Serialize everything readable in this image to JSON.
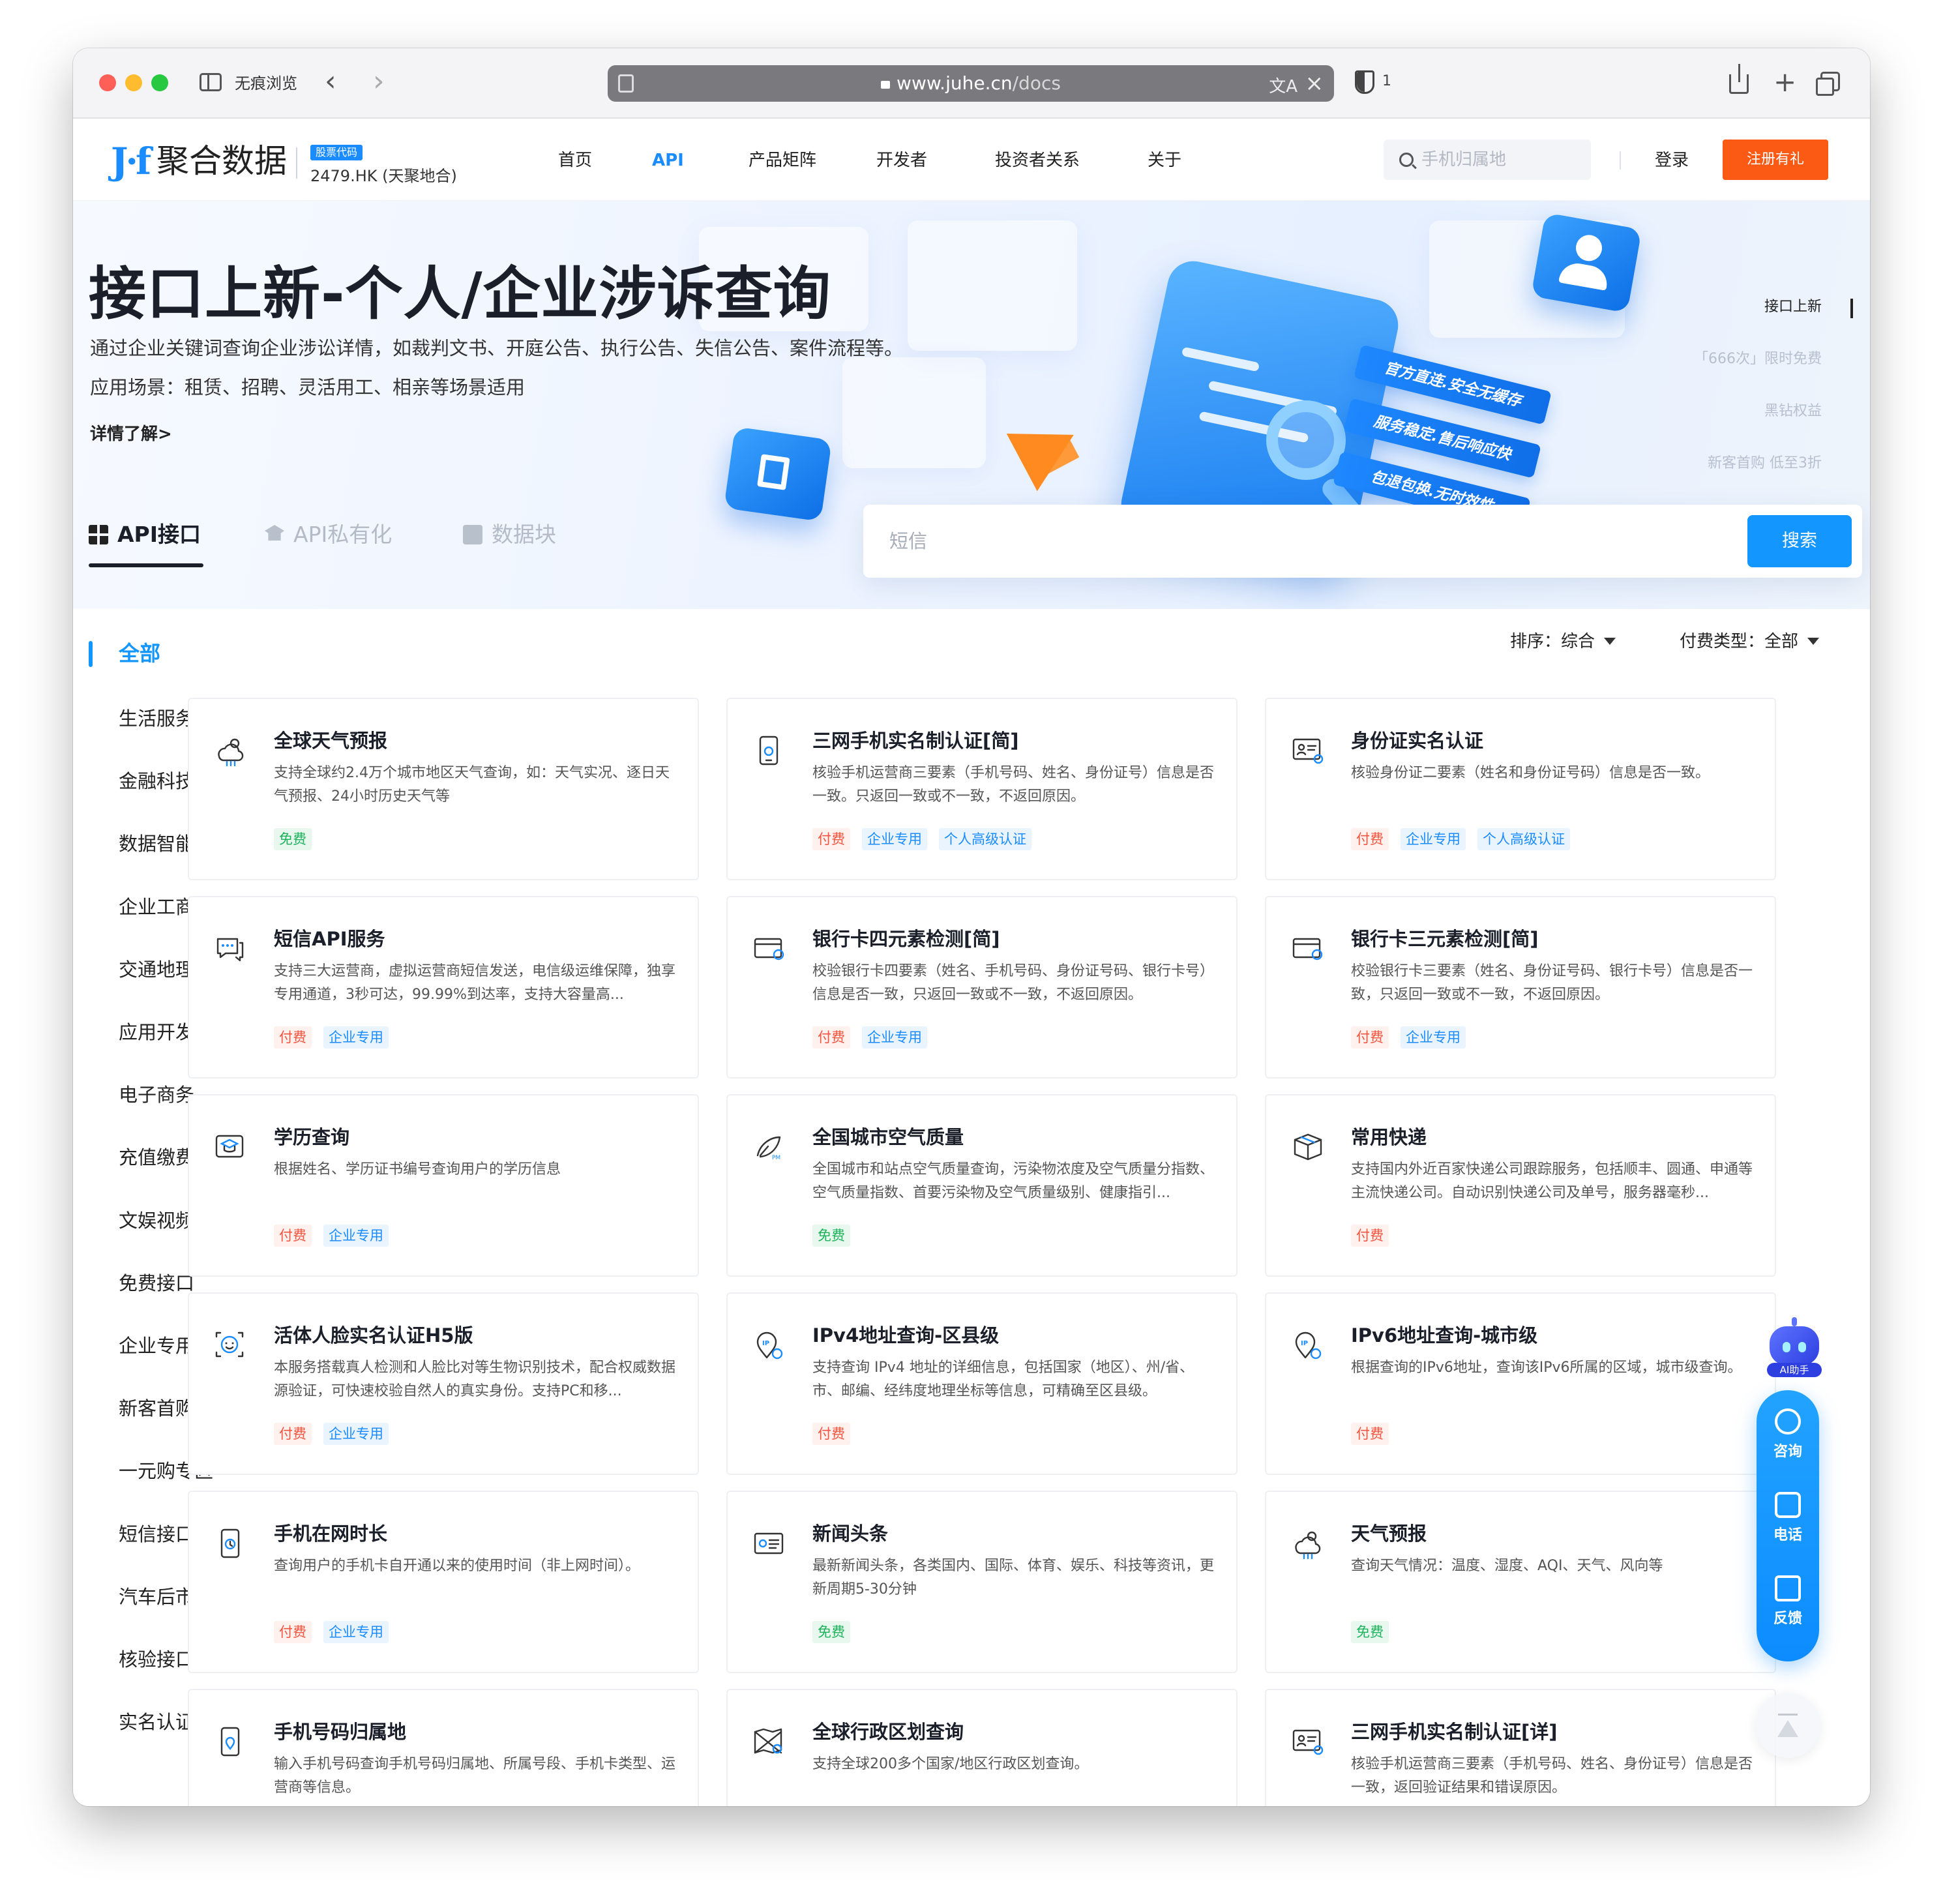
{
  "browser": {
    "private_label": "无痕浏览",
    "url_host": "www.juhe.cn",
    "url_path": "/docs",
    "privacy_count": "1"
  },
  "header": {
    "logo_mark": "J·f",
    "logo_text": "聚合数据",
    "stock_badge": "股票代码",
    "stock_text": "2479.HK (天聚地合)",
    "nav": [
      "首页",
      "API",
      "产品矩阵",
      "开发者",
      "投资者关系",
      "关于"
    ],
    "search_placeholder": "手机归属地",
    "login": "登录",
    "register": "注册有礼"
  },
  "hero": {
    "title": "接口上新-个人/企业涉诉查询",
    "desc": "通过企业关键词查询企业涉讼详情，如裁判文书、开庭公告、执行公告、失信公告、案件流程等。",
    "scene": "应用场景：租赁、招聘、灵活用工、相亲等场景适用",
    "more": "详情了解>",
    "ribbons": [
      "官方直连.安全无缓存",
      "服务稳定.售后响应快",
      "包退包换.无时效性"
    ],
    "side": [
      "接口上新",
      "「666次」限时免费",
      "黑钻权益",
      "新客首购 低至3折"
    ]
  },
  "tabs": [
    "API接口",
    "API私有化",
    "数据块"
  ],
  "search": {
    "placeholder": "短信",
    "button": "搜索"
  },
  "categories": [
    "全部",
    "生活服务",
    "金融科技",
    "数据智能",
    "企业工商",
    "交通地理",
    "应用开发",
    "电子商务",
    "充值缴费",
    "文娱视频",
    "免费接口",
    "企业专用",
    "新客首购特惠",
    "一元购专区",
    "短信接口",
    "汽车后市场",
    "核验接口",
    "实名认证"
  ],
  "sort": {
    "order_label": "排序：综合",
    "fee_label": "付费类型：全部"
  },
  "cards": [
    {
      "title": "全球天气预报",
      "desc": "支持全球约2.4万个城市地区天气查询，如：天气实况、逐日天气预报、24小时历史天气等",
      "icon": "weather-icon",
      "tags": [
        {
          "t": "免费",
          "k": "free"
        }
      ]
    },
    {
      "title": "三网手机实名制认证[简]",
      "desc": "核验手机运营商三要素（手机号码、姓名、身份证号）信息是否一致。只返回一致或不一致，不返回原因。",
      "icon": "phone-verify-icon",
      "tags": [
        {
          "t": "付费",
          "k": "paid"
        },
        {
          "t": "企业专用",
          "k": "ent"
        },
        {
          "t": "个人高级认证",
          "k": "adv"
        }
      ]
    },
    {
      "title": "身份证实名认证",
      "desc": "核验身份证二要素（姓名和身份证号码）信息是否一致。",
      "icon": "id-card-icon",
      "tags": [
        {
          "t": "付费",
          "k": "paid"
        },
        {
          "t": "企业专用",
          "k": "ent"
        },
        {
          "t": "个人高级认证",
          "k": "adv"
        }
      ]
    },
    {
      "title": "短信API服务",
      "desc": "支持三大运营商，虚拟运营商短信发送，电信级运维保障，独享专用通道，3秒可达，99.99%到达率，支持大容量高...",
      "icon": "sms-icon",
      "tags": [
        {
          "t": "付费",
          "k": "paid"
        },
        {
          "t": "企业专用",
          "k": "ent"
        }
      ]
    },
    {
      "title": "银行卡四元素检测[简]",
      "desc": "校验银行卡四要素（姓名、手机号码、身份证号码、银行卡号）信息是否一致，只返回一致或不一致，不返回原因。",
      "icon": "bank-card-icon",
      "tags": [
        {
          "t": "付费",
          "k": "paid"
        },
        {
          "t": "企业专用",
          "k": "ent"
        }
      ]
    },
    {
      "title": "银行卡三元素检测[简]",
      "desc": "校验银行卡三要素（姓名、身份证号码、银行卡号）信息是否一致，只返回一致或不一致，不返回原因。",
      "icon": "bank-card-icon",
      "tags": [
        {
          "t": "付费",
          "k": "paid"
        },
        {
          "t": "企业专用",
          "k": "ent"
        }
      ]
    },
    {
      "title": "学历查询",
      "desc": "根据姓名、学历证书编号查询用户的学历信息",
      "icon": "education-icon",
      "tags": [
        {
          "t": "付费",
          "k": "paid"
        },
        {
          "t": "企业专用",
          "k": "ent"
        }
      ]
    },
    {
      "title": "全国城市空气质量",
      "desc": "全国城市和站点空气质量查询，污染物浓度及空气质量分指数、空气质量指数、首要污染物及空气质量级别、健康指引...",
      "icon": "air-quality-icon",
      "tags": [
        {
          "t": "免费",
          "k": "free"
        }
      ]
    },
    {
      "title": "常用快递",
      "desc": "支持国内外近百家快递公司跟踪服务，包括顺丰、圆通、申通等主流快递公司。自动识别快递公司及单号，服务器毫秒...",
      "icon": "package-icon",
      "tags": [
        {
          "t": "付费",
          "k": "paid"
        }
      ]
    },
    {
      "title": "活体人脸实名认证H5版",
      "desc": "本服务搭载真人检测和人脸比对等生物识别技术，配合权威数据源验证，可快速校验自然人的真实身份。支持PC和移...",
      "icon": "face-icon",
      "tags": [
        {
          "t": "付费",
          "k": "paid"
        },
        {
          "t": "企业专用",
          "k": "ent"
        }
      ]
    },
    {
      "title": "IPv4地址查询-区县级",
      "desc": "支持查询 IPv4 地址的详细信息，包括国家（地区）、州/省、市、邮编、经纬度地理坐标等信息，可精确至区县级。",
      "icon": "ipv4-icon",
      "tags": [
        {
          "t": "付费",
          "k": "paid"
        }
      ]
    },
    {
      "title": "IPv6地址查询-城市级",
      "desc": "根据查询的IPv6地址，查询该IPv6所属的区域，城市级查询。",
      "icon": "ipv6-icon",
      "tags": [
        {
          "t": "付费",
          "k": "paid"
        }
      ]
    },
    {
      "title": "手机在网时长",
      "desc": "查询用户的手机卡自开通以来的使用时间（非上网时间）。",
      "icon": "phone-clock-icon",
      "tags": [
        {
          "t": "付费",
          "k": "paid"
        },
        {
          "t": "企业专用",
          "k": "ent"
        }
      ]
    },
    {
      "title": "新闻头条",
      "desc": "最新新闻头条，各类国内、国际、体育、娱乐、科技等资讯，更新周期5-30分钟",
      "icon": "news-icon",
      "tags": [
        {
          "t": "免费",
          "k": "free"
        }
      ]
    },
    {
      "title": "天气预报",
      "desc": "查询天气情况：温度、湿度、AQI、天气、风向等",
      "icon": "weather-icon",
      "tags": [
        {
          "t": "免费",
          "k": "free"
        }
      ]
    },
    {
      "title": "手机号码归属地",
      "desc": "输入手机号码查询手机号码归属地、所属号段、手机卡类型、运营商等信息。",
      "icon": "phone-location-icon",
      "tags": []
    },
    {
      "title": "全球行政区划查询",
      "desc": "支持全球200多个国家/地区行政区划查询。",
      "icon": "map-icon",
      "tags": []
    },
    {
      "title": "三网手机实名制认证[详]",
      "desc": "核验手机运营商三要素（手机号码、姓名、身份证号）信息是否一致，返回验证结果和错误原因。",
      "icon": "id-card-icon",
      "tags": []
    }
  ],
  "widget": {
    "robot_label": "AI助手",
    "consult": "咨询",
    "phone": "电话",
    "feedback": "反馈"
  },
  "colors": {
    "brand_blue": "#1496ff",
    "register_orange": "#fa5a14",
    "free_green": "#1bb35a",
    "paid_red": "#f5533d"
  }
}
